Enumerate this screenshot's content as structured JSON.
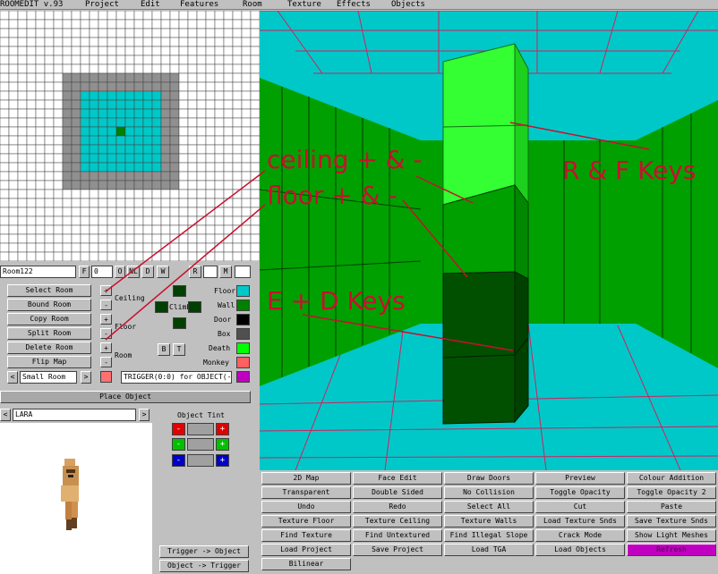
{
  "app": {
    "title": "ROOMEDIT v.93"
  },
  "menu": [
    "Project",
    "Edit",
    "Features",
    "Room",
    "Texture",
    "Effects",
    "Objects"
  ],
  "room": {
    "name": "Room122",
    "f_label": "F",
    "f_value": "0",
    "flags": [
      "O",
      "NL",
      "D",
      "W"
    ],
    "r_label": "R",
    "m_label": "M"
  },
  "room_buttons": [
    "Select Room",
    "Bound Room",
    "Copy Room",
    "Split Room",
    "Delete Room",
    "Flip Map"
  ],
  "room_size": {
    "value": "Small Room",
    "left_arrow": "<",
    "right_arrow": ">"
  },
  "height_controls": {
    "ceiling_label": "Ceiling",
    "floor_label": "Floor",
    "room_label": "Room",
    "ceiling_plus": "+",
    "ceiling_minus": "-",
    "floor_plus": "+",
    "floor_minus": "-",
    "room_plus": "+",
    "room_minus": "-"
  },
  "climb": {
    "label": "Climb"
  },
  "bt_buttons": [
    "B",
    "T"
  ],
  "trigger_text": "TRIGGER(0:0) for OBJECT(-",
  "legend": [
    {
      "label": "Floor",
      "color": "#00c8c8"
    },
    {
      "label": "Wall",
      "color": "#008000"
    },
    {
      "label": "Door",
      "color": "#000000"
    },
    {
      "label": "Box",
      "color": "#505050"
    },
    {
      "label": "Death",
      "color": "#00ff00"
    },
    {
      "label": "Monkey",
      "color": "#ff6060"
    },
    {
      "label": "",
      "color": "#c000c0"
    }
  ],
  "place_object": {
    "label": "Place Object"
  },
  "object": {
    "name": "LARA",
    "left_arrow": "<",
    "right_arrow": ">"
  },
  "object_tint": {
    "label": "Object Tint",
    "minus": "-",
    "plus": "+"
  },
  "trigger_buttons": [
    "Trigger -> Object",
    "Object -> Trigger"
  ],
  "toolbar": [
    [
      "2D Map",
      "Face Edit",
      "Draw Doors",
      "Preview",
      "Colour Addition"
    ],
    [
      "Transparent",
      "Double Sided",
      "No Collision",
      "Toggle Opacity",
      "Toggle Opacity 2"
    ],
    [
      "Undo",
      "Redo",
      "Select All",
      "Cut",
      "Paste"
    ],
    [
      "Texture Floor",
      "Texture Ceiling",
      "Texture Walls",
      "Load Texture Snds",
      "Save Texture Snds"
    ],
    [
      "Find Texture",
      "Find Untextured",
      "Find Illegal Slope",
      "Crack Mode",
      "Show Light Meshes"
    ],
    [
      "Load Project",
      "Save Project",
      "Load TGA",
      "Load Objects",
      "Refresh"
    ],
    [
      "Bilinear"
    ]
  ],
  "annotations": {
    "ceiling": "ceiling + & -",
    "floor": "floor + & -",
    "rf": "R & F Keys",
    "ed": "E + D Keys"
  },
  "colors": {
    "floor": "#00c8c8",
    "wall": "#009000",
    "pillar_top": "#33ff33",
    "pillar_mid": "#00a000",
    "pillar_low": "#005000",
    "annotation": "#c8102e",
    "refresh_button": "#c000c0"
  }
}
